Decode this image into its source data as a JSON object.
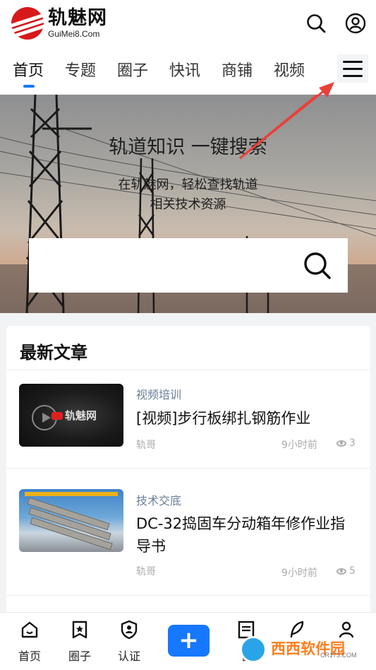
{
  "header": {
    "logo_cn": "轨魅网",
    "logo_en": "GuiMei8.Com",
    "search_icon": "search-icon",
    "user_icon": "user-icon"
  },
  "nav": {
    "tabs": [
      {
        "label": "首页",
        "active": true
      },
      {
        "label": "专题",
        "active": false
      },
      {
        "label": "圈子",
        "active": false
      },
      {
        "label": "快讯",
        "active": false
      },
      {
        "label": "商铺",
        "active": false
      },
      {
        "label": "视频",
        "active": false
      }
    ],
    "menu_icon": "hamburger-menu-icon",
    "accent_color": "#1677ff"
  },
  "hero": {
    "title": "轨道知识 一键搜索",
    "subtitle_line1": "在轨魅网，轻松查找轨道",
    "subtitle_line2": "相关技术资源",
    "search_placeholder": "",
    "search_button_icon": "search-icon"
  },
  "latest": {
    "title": "最新文章",
    "articles": [
      {
        "category": "视频培训",
        "title": "[视频]步行板绑扎钢筋作业",
        "author": "轨哥",
        "time": "9小时前",
        "views": "3",
        "thumb_logo": "轨魅网"
      },
      {
        "category": "技术交底",
        "title": "DC-32捣固车分动箱年修作业指导书",
        "author": "轨哥",
        "time": "9小时前",
        "views": "5"
      }
    ]
  },
  "bottom_nav": {
    "items": [
      {
        "label": "首页",
        "icon": "home-icon"
      },
      {
        "label": "圈子",
        "icon": "star-bookmark-icon"
      },
      {
        "label": "认证",
        "icon": "shield-user-icon"
      },
      {
        "label": "+",
        "icon": "plus-icon"
      },
      {
        "label": "管",
        "icon": "list-icon"
      },
      {
        "label": "",
        "icon": "feather-icon"
      },
      {
        "label": "",
        "icon": "user-icon"
      }
    ]
  },
  "watermark": {
    "text": "西西软件园",
    "url": "CR173.COM"
  }
}
